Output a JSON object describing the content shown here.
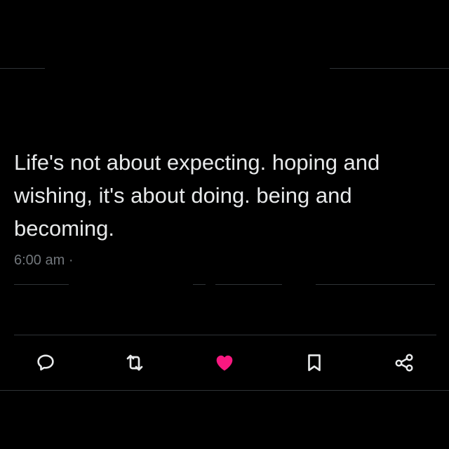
{
  "tweet": {
    "text": "Life's not about expecting. hoping and wishing, it's about doing. being and becoming.",
    "time": "6:00 am",
    "separator": "·"
  },
  "actions": {
    "reply_icon": "reply-icon",
    "retweet_icon": "retweet-icon",
    "like_icon": "heart-icon",
    "bookmark_icon": "bookmark-icon",
    "share_icon": "share-icon",
    "liked": true
  },
  "colors": {
    "background": "#000000",
    "text": "#e7e9ea",
    "muted": "#71767b",
    "divider": "#2f3336",
    "like": "#f91880"
  }
}
